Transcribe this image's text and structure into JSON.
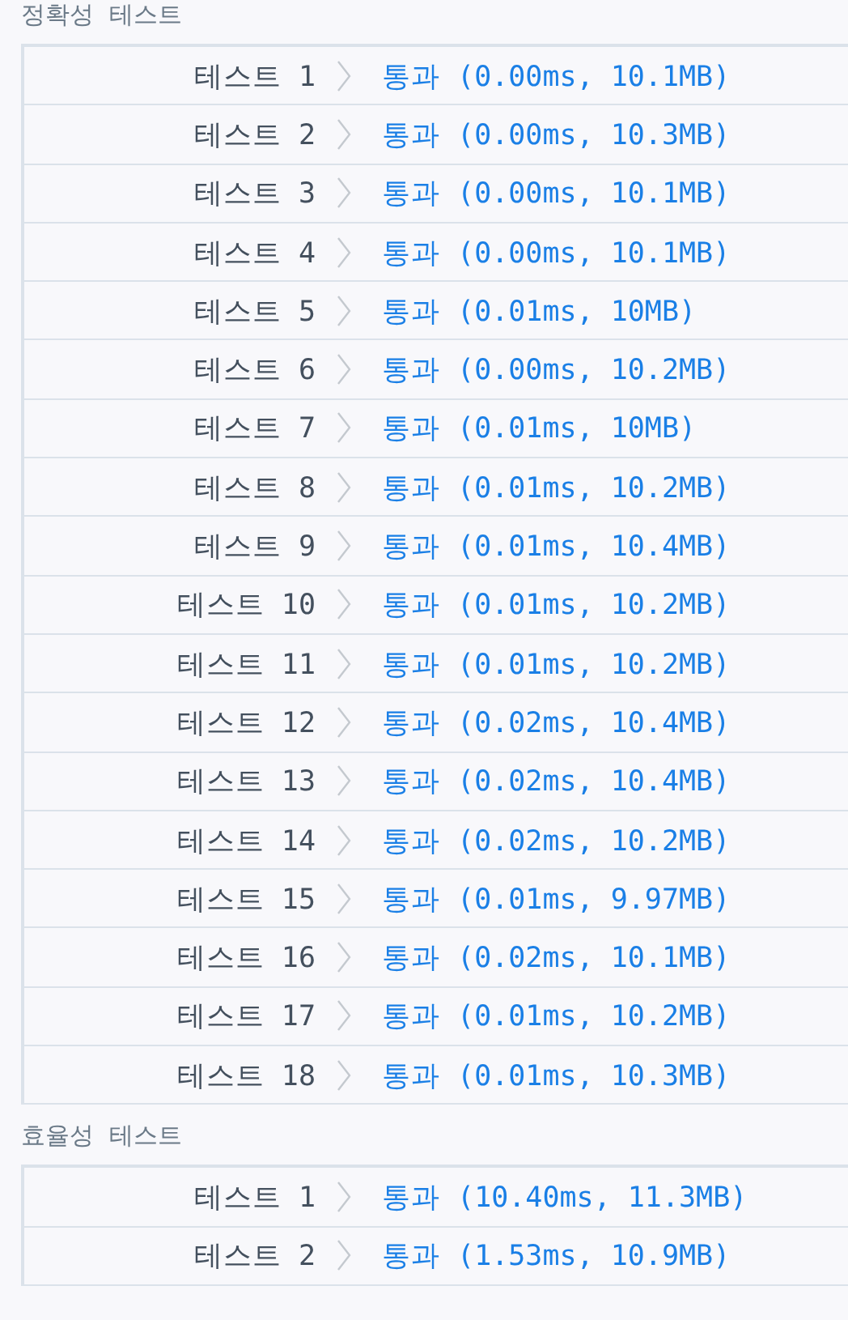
{
  "sections": [
    {
      "title": "정확성  테스트",
      "rows": [
        {
          "label": "테스트 1",
          "result": "통과 (0.00ms, 10.1MB)"
        },
        {
          "label": "테스트 2",
          "result": "통과 (0.00ms, 10.3MB)"
        },
        {
          "label": "테스트 3",
          "result": "통과 (0.00ms, 10.1MB)"
        },
        {
          "label": "테스트 4",
          "result": "통과 (0.00ms, 10.1MB)"
        },
        {
          "label": "테스트 5",
          "result": "통과 (0.01ms, 10MB)"
        },
        {
          "label": "테스트 6",
          "result": "통과 (0.00ms, 10.2MB)"
        },
        {
          "label": "테스트 7",
          "result": "통과 (0.01ms, 10MB)"
        },
        {
          "label": "테스트 8",
          "result": "통과 (0.01ms, 10.2MB)"
        },
        {
          "label": "테스트 9",
          "result": "통과 (0.01ms, 10.4MB)"
        },
        {
          "label": "테스트 10",
          "result": "통과 (0.01ms, 10.2MB)"
        },
        {
          "label": "테스트 11",
          "result": "통과 (0.01ms, 10.2MB)"
        },
        {
          "label": "테스트 12",
          "result": "통과 (0.02ms, 10.4MB)"
        },
        {
          "label": "테스트 13",
          "result": "통과 (0.02ms, 10.4MB)"
        },
        {
          "label": "테스트 14",
          "result": "통과 (0.02ms, 10.2MB)"
        },
        {
          "label": "테스트 15",
          "result": "통과 (0.01ms, 9.97MB)"
        },
        {
          "label": "테스트 16",
          "result": "통과 (0.02ms, 10.1MB)"
        },
        {
          "label": "테스트 17",
          "result": "통과 (0.01ms, 10.2MB)"
        },
        {
          "label": "테스트 18",
          "result": "통과 (0.01ms, 10.3MB)"
        }
      ]
    },
    {
      "title": "효율성  테스트",
      "rows": [
        {
          "label": "테스트 1",
          "result": "통과 (10.40ms, 11.3MB)"
        },
        {
          "label": "테스트 2",
          "result": "통과 (1.53ms, 10.9MB)"
        }
      ]
    }
  ]
}
